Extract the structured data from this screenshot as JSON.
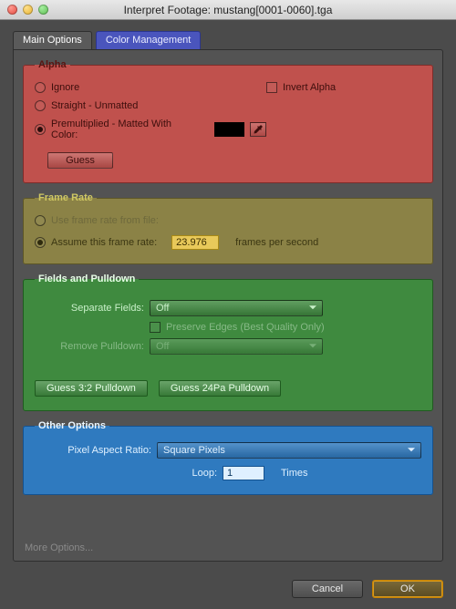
{
  "window": {
    "title": "Interpret Footage: mustang[0001-0060].tga"
  },
  "tabs": {
    "main": "Main Options",
    "color": "Color Management"
  },
  "alpha": {
    "legend": "Alpha",
    "ignore": "Ignore",
    "straight": "Straight - Unmatted",
    "premult": "Premultiplied - Matted With Color:",
    "invert": "Invert Alpha",
    "guess": "Guess",
    "swatch_color": "#000000",
    "selected": "premult"
  },
  "framerate": {
    "legend": "Frame Rate",
    "from_file": "Use frame rate from file:",
    "assume": "Assume this frame rate:",
    "value": "23.976",
    "units": "frames per second",
    "selected": "assume"
  },
  "fields": {
    "legend": "Fields and Pulldown",
    "separate_label": "Separate Fields:",
    "separate_value": "Off",
    "preserve": "Preserve Edges (Best Quality Only)",
    "remove_label": "Remove Pulldown:",
    "remove_value": "Off",
    "guess32": "Guess 3:2 Pulldown",
    "guess24": "Guess 24Pa Pulldown"
  },
  "other": {
    "legend": "Other Options",
    "par_label": "Pixel Aspect Ratio:",
    "par_value": "Square Pixels",
    "loop_label": "Loop:",
    "loop_value": "1",
    "loop_units": "Times"
  },
  "more": "More Options...",
  "footer": {
    "cancel": "Cancel",
    "ok": "OK"
  }
}
